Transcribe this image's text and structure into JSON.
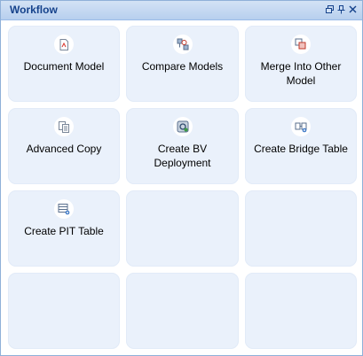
{
  "panel": {
    "title": "Workflow",
    "tools": [
      {
        "icon": "restore-window-icon"
      },
      {
        "icon": "pin-icon"
      },
      {
        "icon": "close-icon"
      }
    ]
  },
  "tiles": [
    {
      "label": "Document Model",
      "icon": "document-icon"
    },
    {
      "label": "Compare Models",
      "icon": "compare-icon"
    },
    {
      "label": "Merge Into Other Model",
      "icon": "merge-icon"
    },
    {
      "label": "Advanced Copy",
      "icon": "copy-icon"
    },
    {
      "label": "Create BV Deployment",
      "icon": "deployment-icon"
    },
    {
      "label": "Create Bridge Table",
      "icon": "bridge-table-icon"
    },
    {
      "label": "Create PIT Table",
      "icon": "pit-table-icon"
    }
  ],
  "colors": {
    "title_text": "#15428b",
    "tile_bg": "#eaf1fb",
    "border": "#8fb0d8"
  }
}
